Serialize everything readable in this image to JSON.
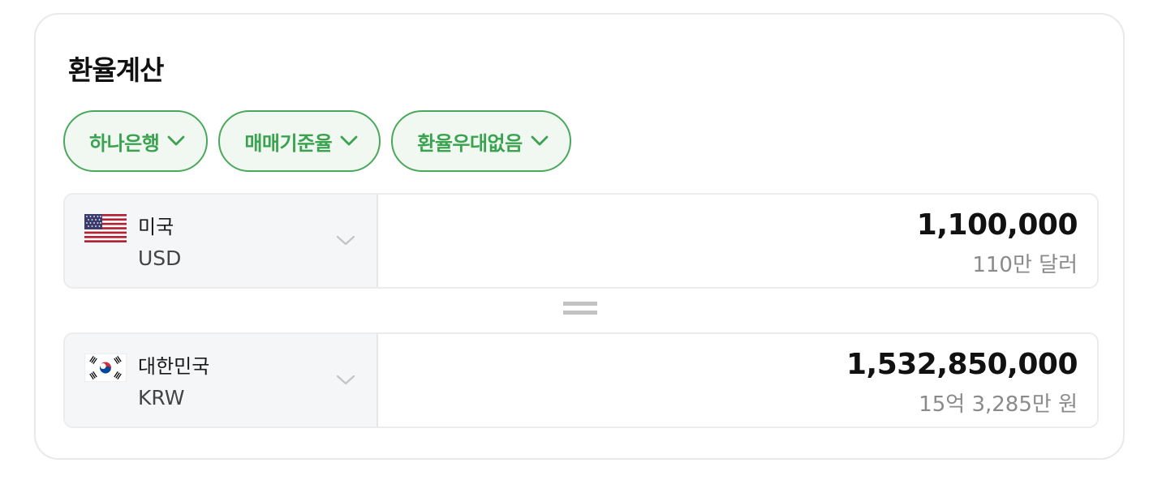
{
  "calculator": {
    "title": "환율계산",
    "filters": [
      {
        "label": "하나은행"
      },
      {
        "label": "매매기준율"
      },
      {
        "label": "환율우대없음"
      }
    ],
    "from": {
      "country": "미국",
      "currency": "USD",
      "flag_icon": "us-flag-icon",
      "amount": "1,100,000",
      "amount_text": "110만 달러"
    },
    "equals_icon": "equals-icon",
    "to": {
      "country": "대한민국",
      "currency": "KRW",
      "flag_icon": "kr-flag-icon",
      "amount": "1,532,850,000",
      "amount_text": "15억 3,285만 원"
    },
    "colors": {
      "accent_green": "#3ba350",
      "chip_bg": "#f1f8f2",
      "selector_bg": "#f5f6f8"
    }
  }
}
